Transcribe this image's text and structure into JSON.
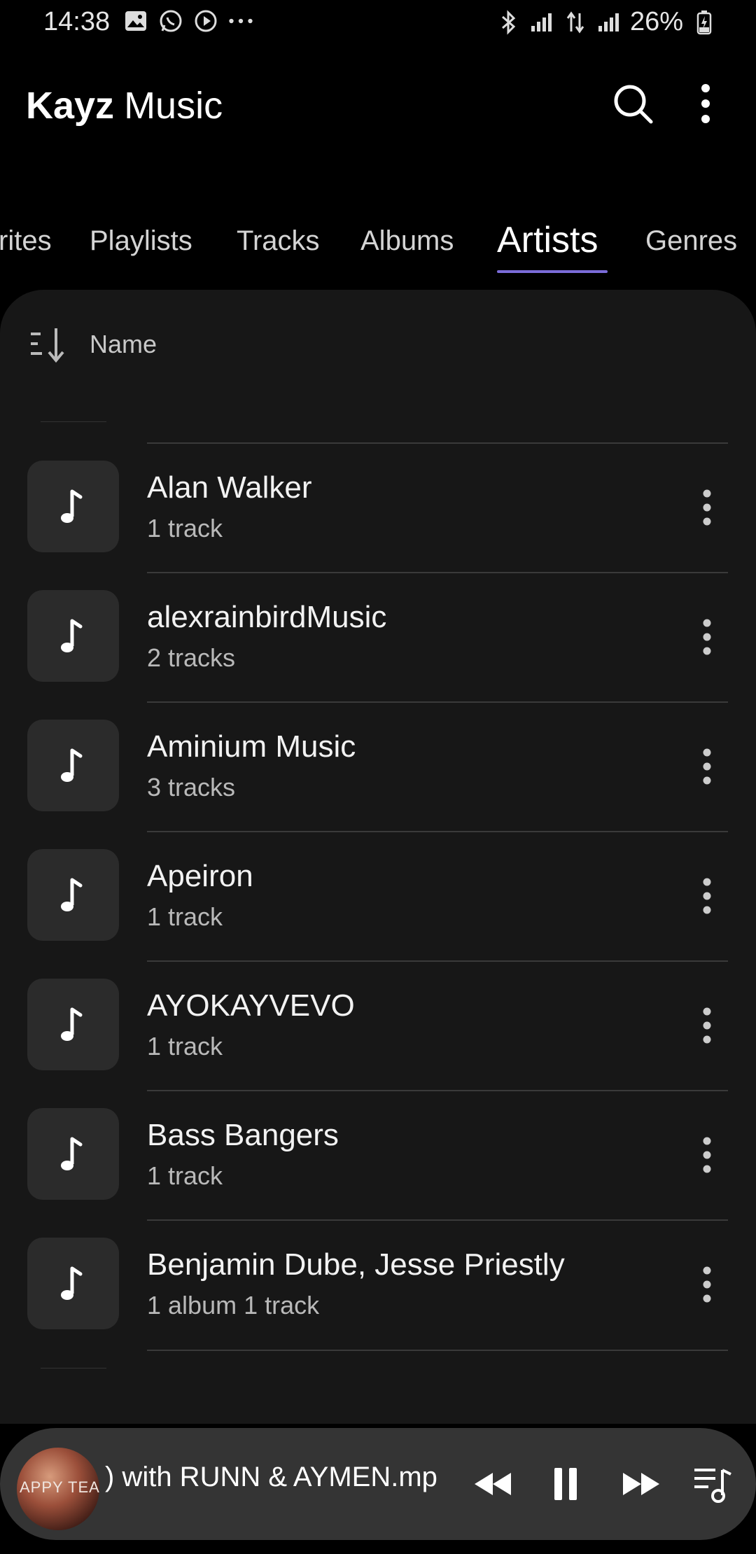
{
  "status_bar": {
    "time": "14:38",
    "battery": "26%",
    "left_icons": [
      "gallery-icon",
      "whatsapp-icon",
      "play-circle-icon",
      "more-dots-icon"
    ],
    "right_icons": [
      "bluetooth-icon",
      "signal-icon",
      "data-arrows-icon",
      "signal-icon",
      "battery-charging-icon"
    ]
  },
  "app": {
    "title_brand": "Kayz",
    "title_suffix": "Music",
    "accent": "#7b6cd9"
  },
  "tabs": [
    {
      "label": "rites",
      "active": false
    },
    {
      "label": "Playlists",
      "active": false
    },
    {
      "label": "Tracks",
      "active": false
    },
    {
      "label": "Albums",
      "active": false
    },
    {
      "label": "Artists",
      "active": true
    },
    {
      "label": "Genres",
      "active": false
    }
  ],
  "sort": {
    "label": "Name"
  },
  "artists": [
    {
      "name": "Alan Walker",
      "count": " 1 track"
    },
    {
      "name": "alexrainbirdMusic",
      "count": " 2 tracks"
    },
    {
      "name": "Aminium Music",
      "count": " 3 tracks"
    },
    {
      "name": "Apeiron",
      "count": " 1 track"
    },
    {
      "name": "AYOKAYVEVO",
      "count": " 1 track"
    },
    {
      "name": "Bass Bangers",
      "count": " 1 track"
    },
    {
      "name": "Benjamin Dube, Jesse Priestly",
      "count": "1  album 1 track"
    }
  ],
  "player": {
    "now_playing": ") with RUNN & AYMEN.mp",
    "art_text": "APPY TEAR"
  }
}
